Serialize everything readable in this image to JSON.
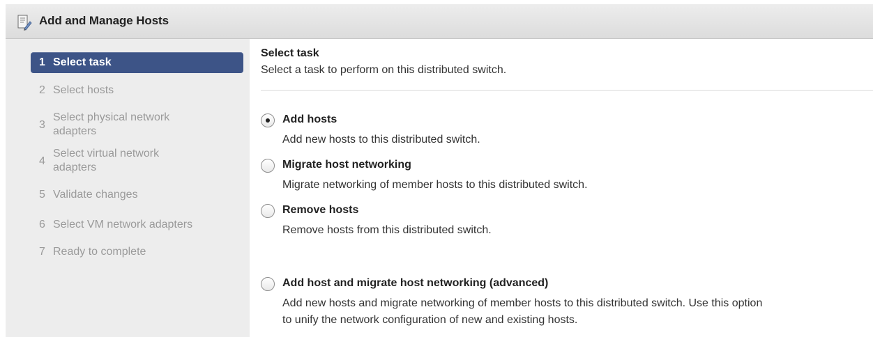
{
  "window": {
    "title": "Add and Manage Hosts",
    "icon": "wizard-icon"
  },
  "steps": [
    {
      "num": "1",
      "label": "Select task",
      "active": true
    },
    {
      "num": "2",
      "label": "Select hosts"
    },
    {
      "num": "3",
      "label_line1": "Select physical network",
      "label_line2": "adapters"
    },
    {
      "num": "4",
      "label_line1": "Select virtual network",
      "label_line2": "adapters"
    },
    {
      "num": "5",
      "label": "Validate changes"
    },
    {
      "num": "6",
      "label": "Select VM network adapters"
    },
    {
      "num": "7",
      "label": "Ready to complete"
    }
  ],
  "content": {
    "title": "Select task",
    "subtitle": "Select a task to perform on this distributed switch."
  },
  "options": [
    {
      "title": "Add hosts",
      "desc": "Add new hosts to this distributed switch.",
      "selected": true
    },
    {
      "title": "Migrate host networking",
      "desc": "Migrate networking of member hosts to this distributed switch.",
      "selected": false
    },
    {
      "title": "Remove hosts",
      "desc": "Remove hosts from this distributed switch.",
      "selected": false
    },
    {
      "title": "Add host and migrate host networking (advanced)",
      "desc_line1": "Add new hosts and migrate networking of member hosts to this distributed switch. Use this option",
      "desc_line2": "to unify the network configuration of new and existing hosts.",
      "selected": false
    }
  ],
  "colors": {
    "active_step": "#3d5487",
    "inactive_step_text": "#9a9a9a",
    "sidebar_bg": "#ededed"
  }
}
